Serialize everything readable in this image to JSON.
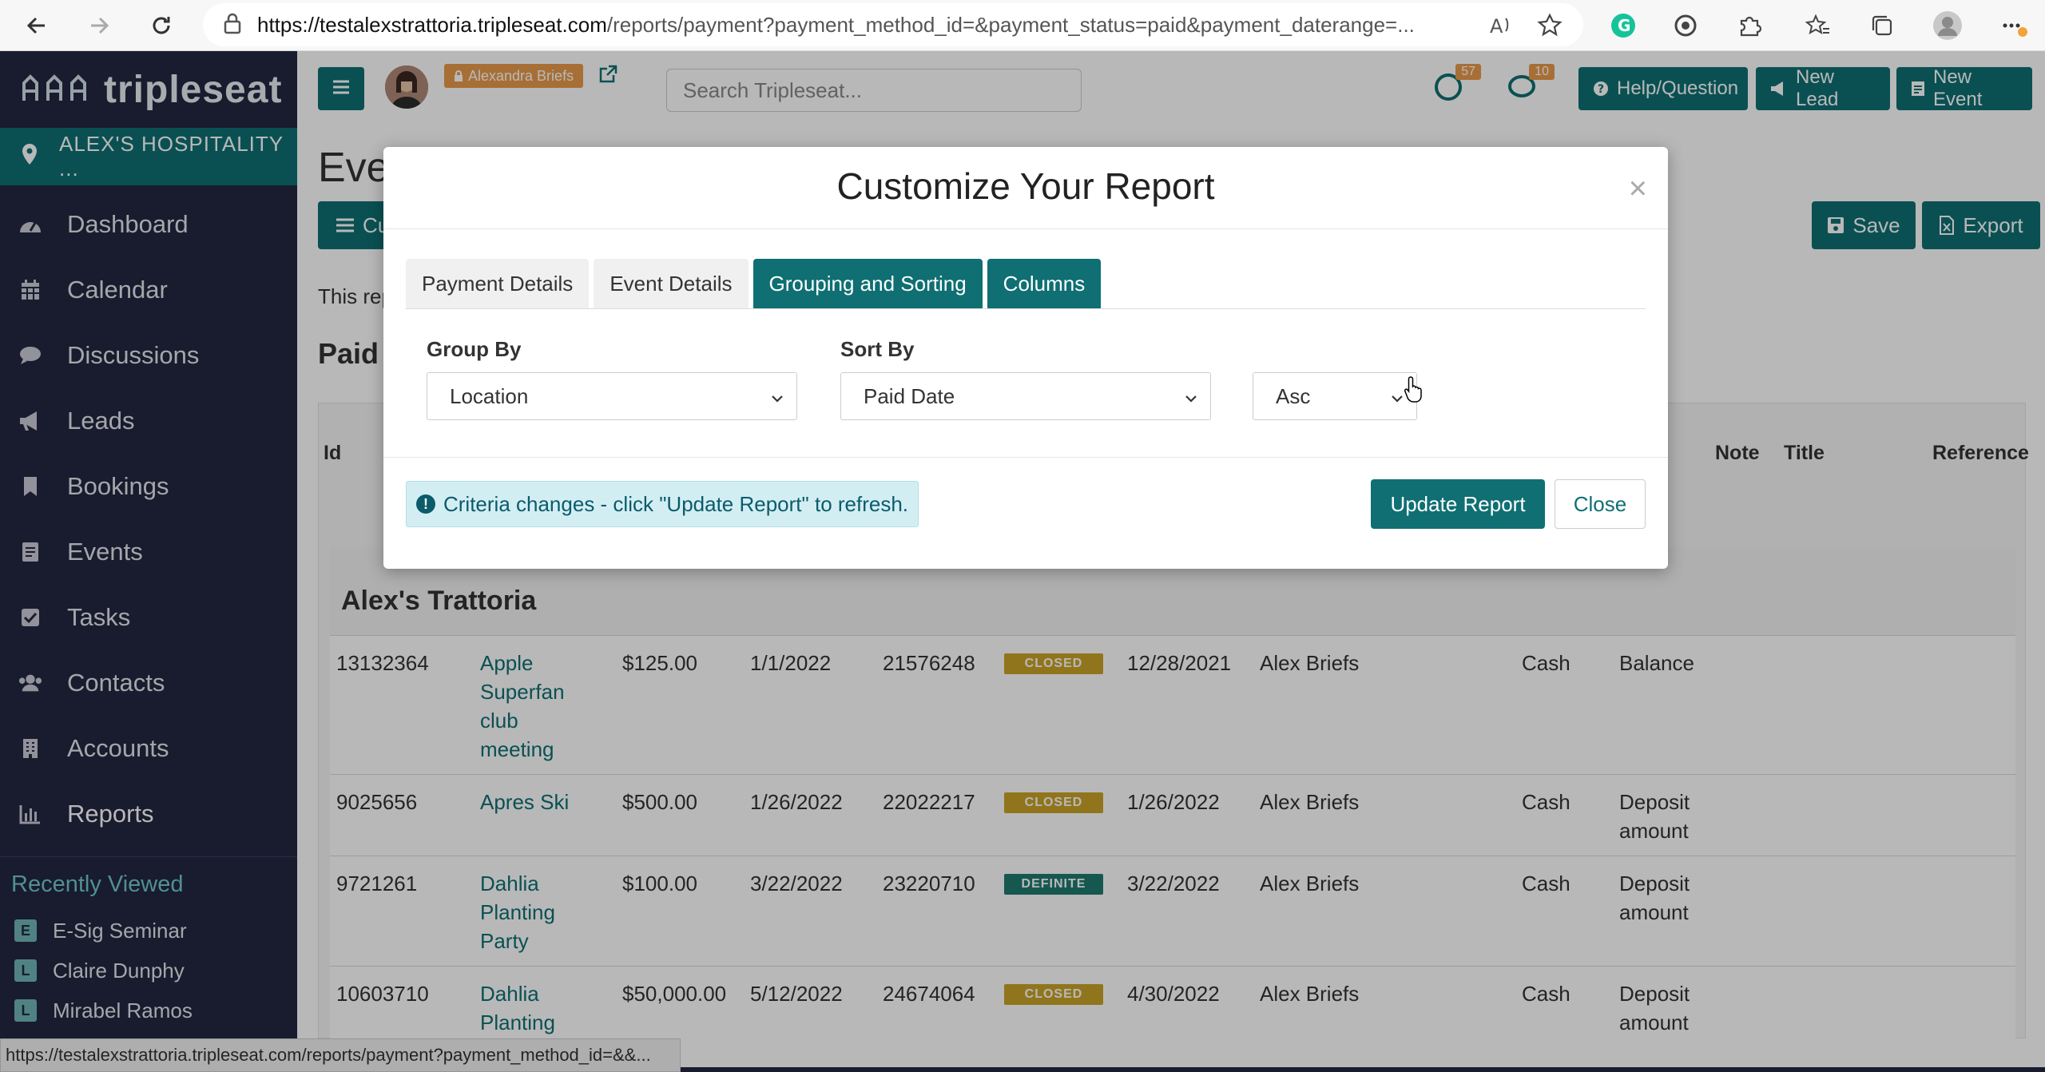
{
  "browser": {
    "url_host": "https://testalexstrattoria.tripleseat.com",
    "url_path": "/reports/payment?payment_method_id=&payment_status=paid&payment_daterange=...",
    "status_url": "https://testalexstrattoria.tripleseat.com/reports/payment?payment_method_id=&&..."
  },
  "brand": {
    "logo_text": "tripleseat",
    "accent": "#0f6f73",
    "sidebar_bg": "#232640"
  },
  "sidebar": {
    "venue": "ALEX'S HOSPITALITY ...",
    "items": [
      {
        "label": "Dashboard",
        "icon": "dashboard-icon"
      },
      {
        "label": "Calendar",
        "icon": "calendar-icon"
      },
      {
        "label": "Discussions",
        "icon": "discussions-icon"
      },
      {
        "label": "Leads",
        "icon": "megaphone-icon"
      },
      {
        "label": "Bookings",
        "icon": "bookmark-icon"
      },
      {
        "label": "Events",
        "icon": "events-icon"
      },
      {
        "label": "Tasks",
        "icon": "check-icon"
      },
      {
        "label": "Contacts",
        "icon": "users-icon"
      },
      {
        "label": "Accounts",
        "icon": "building-icon"
      },
      {
        "label": "Reports",
        "icon": "chart-icon"
      }
    ],
    "recent_title": "Recently Viewed",
    "recent": [
      {
        "badge": "E",
        "label": "E-Sig Seminar"
      },
      {
        "badge": "L",
        "label": "Claire Dunphy"
      },
      {
        "badge": "L",
        "label": "Mirabel Ramos"
      }
    ]
  },
  "header": {
    "impersonate": "Alexandra Briefs",
    "search_placeholder": "Search Tripleseat...",
    "notif_count_1": "57",
    "notif_count_2": "10",
    "help_label": "Help/Question",
    "new_lead_label": "New Lead",
    "new_event_label": "New Event"
  },
  "page": {
    "title": "Eve",
    "customize_label": "Cu",
    "save_label": "Save",
    "export_label": "Export",
    "note": "This rep",
    "section": "Paid"
  },
  "table": {
    "headers": {
      "id": "Id",
      "note": "Note",
      "title": "Title",
      "reference": "Reference"
    },
    "group": "Alex's Trattoria",
    "rows": [
      {
        "id": "13132364",
        "event": "Apple Superfan club meeting",
        "event_lines": [
          "Apple",
          "Superfan",
          "club",
          "meeting"
        ],
        "amount": "$125.00",
        "date": "1/1/2022",
        "num": "21576248",
        "status": "CLOSED",
        "paid": "12/28/2021",
        "owner": "Alex Briefs",
        "method": "Cash",
        "type_lines": [
          "Balance"
        ]
      },
      {
        "id": "9025656",
        "event": "Apres Ski",
        "event_lines": [
          "Apres Ski"
        ],
        "amount": "$500.00",
        "date": "1/26/2022",
        "num": "22022217",
        "status": "CLOSED",
        "paid": "1/26/2022",
        "owner": "Alex Briefs",
        "method": "Cash",
        "type_lines": [
          "Deposit",
          "amount"
        ]
      },
      {
        "id": "9721261",
        "event": "Dahlia Planting Party",
        "event_lines": [
          "Dahlia",
          "Planting",
          "Party"
        ],
        "amount": "$100.00",
        "date": "3/22/2022",
        "num": "23220710",
        "status": "DEFINITE",
        "paid": "3/22/2022",
        "owner": "Alex Briefs",
        "method": "Cash",
        "type_lines": [
          "Deposit",
          "amount"
        ]
      },
      {
        "id": "10603710",
        "event": "Dahlia Planting",
        "event_lines": [
          "Dahlia",
          "Planting"
        ],
        "amount": "$50,000.00",
        "date": "5/12/2022",
        "num": "24674064",
        "status": "CLOSED",
        "paid": "4/30/2022",
        "owner": "Alex Briefs",
        "method": "Cash",
        "type_lines": [
          "Deposit",
          "amount"
        ]
      }
    ]
  },
  "modal": {
    "title": "Customize Your Report",
    "close_symbol": "×",
    "tabs": [
      "Payment Details",
      "Event Details",
      "Grouping and Sorting",
      "Columns"
    ],
    "active_tab": "Grouping and Sorting",
    "group_by_label": "Group By",
    "group_by_value": "Location",
    "sort_by_label": "Sort By",
    "sort_by_value": "Paid Date",
    "order_value": "Asc",
    "alert": "Criteria changes - click \"Update Report\" to refresh.",
    "update_label": "Update Report",
    "close_label": "Close"
  }
}
